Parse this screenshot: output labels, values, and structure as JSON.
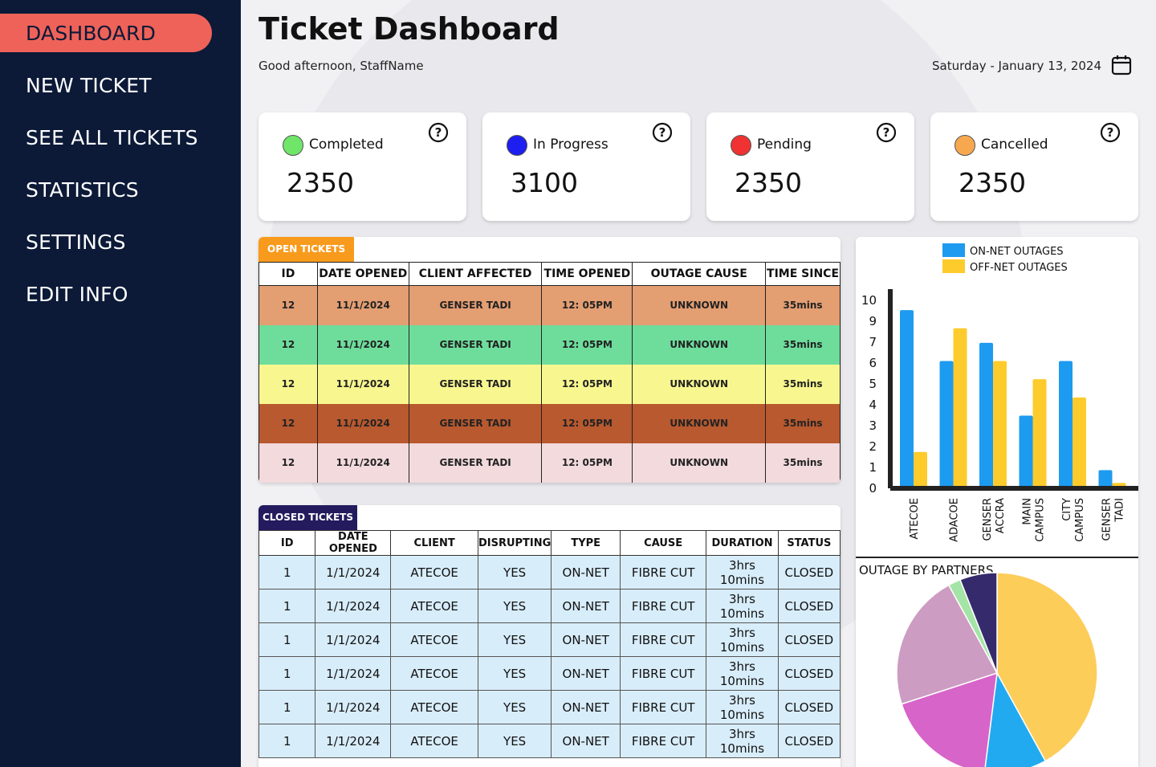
{
  "sidebar": {
    "items": [
      {
        "label": "DASHBOARD",
        "active": true
      },
      {
        "label": "NEW TICKET"
      },
      {
        "label": "SEE ALL TICKETS"
      },
      {
        "label": "STATISTICS"
      },
      {
        "label": "SETTINGS"
      },
      {
        "label": "EDIT INFO"
      }
    ]
  },
  "header": {
    "title": "Ticket Dashboard",
    "greeting": "Good afternoon, StaffName",
    "date": "Saturday - January 13, 2024"
  },
  "cards": [
    {
      "label": "Completed",
      "value": "2350",
      "color": "#6fe56a"
    },
    {
      "label": "In Progress",
      "value": "3100",
      "color": "#1d1ef0"
    },
    {
      "label": "Pending",
      "value": "2350",
      "color": "#f03232"
    },
    {
      "label": "Cancelled",
      "value": "2350",
      "color": "#f7a84e"
    }
  ],
  "open_tickets": {
    "tag": "OPEN TICKETS",
    "tag_color": "#f89a1c",
    "headers": [
      "ID",
      "DATE OPENED",
      "CLIENT AFFECTED",
      "TIME OPENED",
      "OUTAGE CAUSE",
      "TIME SINCE"
    ],
    "rows": [
      {
        "color": "#e39e72",
        "cells": [
          "12",
          "11/1/2024",
          "GENSER TADI",
          "12: 05PM",
          "UNKNOWN",
          "35mins"
        ]
      },
      {
        "color": "#6edd9c",
        "cells": [
          "12",
          "11/1/2024",
          "GENSER TADI",
          "12: 05PM",
          "UNKNOWN",
          "35mins"
        ]
      },
      {
        "color": "#f8f78f",
        "cells": [
          "12",
          "11/1/2024",
          "GENSER TADI",
          "12: 05PM",
          "UNKNOWN",
          "35mins"
        ]
      },
      {
        "color": "#b8592f",
        "cells": [
          "12",
          "11/1/2024",
          "GENSER TADI",
          "12: 05PM",
          "UNKNOWN",
          "35mins"
        ]
      },
      {
        "color": "#f2dadd",
        "cells": [
          "12",
          "11/1/2024",
          "GENSER TADI",
          "12: 05PM",
          "UNKNOWN",
          "35mins"
        ]
      }
    ]
  },
  "closed_tickets": {
    "tag": "CLOSED TICKETS",
    "tag_color": "#231b5e",
    "row_color": "#d8edfa",
    "headers": [
      "ID",
      "DATE OPENED",
      "CLIENT",
      "DISRUPTING",
      "TYPE",
      "CAUSE",
      "DURATION",
      "STATUS"
    ],
    "rows": [
      [
        "1",
        "1/1/2024",
        "ATECOE",
        "YES",
        "ON-NET",
        "FIBRE CUT",
        "3hrs 10mins",
        "CLOSED"
      ],
      [
        "1",
        "1/1/2024",
        "ATECOE",
        "YES",
        "ON-NET",
        "FIBRE CUT",
        "3hrs 10mins",
        "CLOSED"
      ],
      [
        "1",
        "1/1/2024",
        "ATECOE",
        "YES",
        "ON-NET",
        "FIBRE CUT",
        "3hrs 10mins",
        "CLOSED"
      ],
      [
        "1",
        "1/1/2024",
        "ATECOE",
        "YES",
        "ON-NET",
        "FIBRE CUT",
        "3hrs 10mins",
        "CLOSED"
      ],
      [
        "1",
        "1/1/2024",
        "ATECOE",
        "YES",
        "ON-NET",
        "FIBRE CUT",
        "3hrs 10mins",
        "CLOSED"
      ],
      [
        "1",
        "1/1/2024",
        "ATECOE",
        "YES",
        "ON-NET",
        "FIBRE CUT",
        "3hrs 10mins",
        "CLOSED"
      ]
    ]
  },
  "chart_data": [
    {
      "type": "bar",
      "categories": [
        [
          "ATECOE"
        ],
        [
          "ADACOE"
        ],
        [
          "GENSER",
          "ACCRA"
        ],
        [
          "MAIN",
          "CAMPUS"
        ],
        [
          "CITY",
          "CAMPUS"
        ],
        [
          "GENSER",
          "TADI"
        ]
      ],
      "series": [
        {
          "name": "ON-NET OUTAGES",
          "color": "#1d9bf0",
          "values": [
            9.8,
            7.0,
            8.0,
            4.0,
            7.0,
            1.0
          ]
        },
        {
          "name": "OFF-NET OUTAGES",
          "color": "#fdcb2c",
          "values": [
            2.0,
            8.8,
            7.0,
            6.0,
            5.0,
            0.3
          ]
        }
      ],
      "y_ticks": [
        "0",
        "1",
        "2",
        "3",
        "4",
        "5",
        "6",
        "7",
        "9",
        "10"
      ],
      "legend": "top"
    },
    {
      "type": "pie",
      "title": "OUTAGE BY PARTNERS",
      "slices": [
        {
          "value": 42,
          "color": "#fdcd5a"
        },
        {
          "value": 10,
          "color": "#22aaf0"
        },
        {
          "value": 18,
          "color": "#d764c9"
        },
        {
          "value": 22,
          "color": "#cd9cc2"
        },
        {
          "value": 2,
          "color": "#a4e4a6"
        },
        {
          "value": 6,
          "color": "#352a6b"
        }
      ]
    }
  ]
}
